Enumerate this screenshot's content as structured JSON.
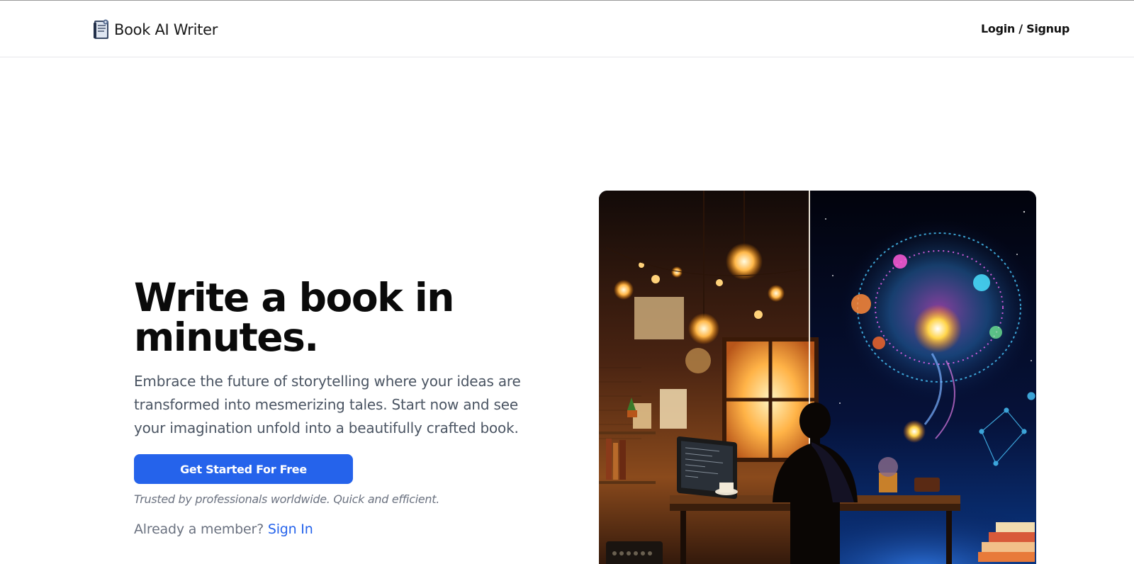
{
  "brand": {
    "name": "Book AI Writer",
    "logo_icon": "book-logo-icon"
  },
  "nav": {
    "login_label": "Login / Signup"
  },
  "hero": {
    "title_line1": "Write a book in",
    "title_line2": "minutes.",
    "subtitle": "Embrace the future of storytelling where your ideas are transformed into mesmerizing tales. Start now and see your imagination unfold into a beautifully crafted book.",
    "cta_label": "Get Started For Free",
    "trust_text": "Trusted by professionals worldwide. Quick and efficient.",
    "member_prompt": "Already a member?",
    "sign_in_label": "Sign In"
  },
  "colors": {
    "accent": "#2563eb",
    "text_dark": "#0a0a0a",
    "text_muted": "#4b5563"
  }
}
